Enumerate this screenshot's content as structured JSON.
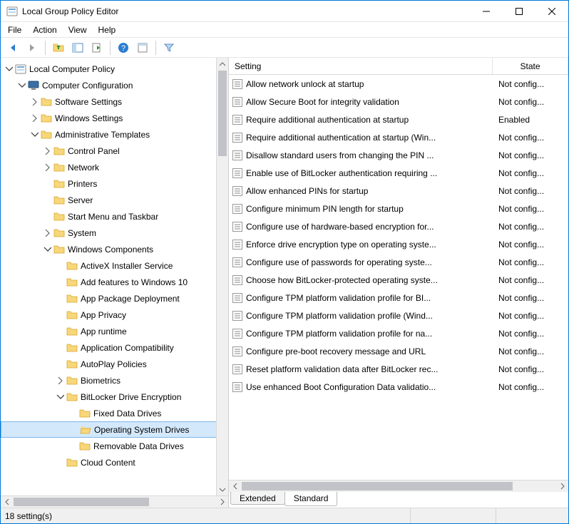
{
  "window": {
    "title": "Local Group Policy Editor"
  },
  "menubar": {
    "items": [
      "File",
      "Action",
      "View",
      "Help"
    ]
  },
  "tree": {
    "root": "Local Computer Policy",
    "nodes": [
      {
        "depth": 0,
        "exp": "open",
        "icon": "root",
        "label": "Local Computer Policy"
      },
      {
        "depth": 1,
        "exp": "open",
        "icon": "comp",
        "label": "Computer Configuration"
      },
      {
        "depth": 2,
        "exp": "closed",
        "icon": "folder",
        "label": "Software Settings"
      },
      {
        "depth": 2,
        "exp": "closed",
        "icon": "folder",
        "label": "Windows Settings"
      },
      {
        "depth": 2,
        "exp": "open",
        "icon": "folder",
        "label": "Administrative Templates"
      },
      {
        "depth": 3,
        "exp": "closed",
        "icon": "folder",
        "label": "Control Panel"
      },
      {
        "depth": 3,
        "exp": "closed",
        "icon": "folder",
        "label": "Network"
      },
      {
        "depth": 3,
        "exp": "none",
        "icon": "folder",
        "label": "Printers"
      },
      {
        "depth": 3,
        "exp": "none",
        "icon": "folder",
        "label": "Server"
      },
      {
        "depth": 3,
        "exp": "none",
        "icon": "folder",
        "label": "Start Menu and Taskbar"
      },
      {
        "depth": 3,
        "exp": "closed",
        "icon": "folder",
        "label": "System"
      },
      {
        "depth": 3,
        "exp": "open",
        "icon": "folder",
        "label": "Windows Components"
      },
      {
        "depth": 4,
        "exp": "none",
        "icon": "folder",
        "label": "ActiveX Installer Service"
      },
      {
        "depth": 4,
        "exp": "none",
        "icon": "folder",
        "label": "Add features to Windows 10"
      },
      {
        "depth": 4,
        "exp": "none",
        "icon": "folder",
        "label": "App Package Deployment"
      },
      {
        "depth": 4,
        "exp": "none",
        "icon": "folder",
        "label": "App Privacy"
      },
      {
        "depth": 4,
        "exp": "none",
        "icon": "folder",
        "label": "App runtime"
      },
      {
        "depth": 4,
        "exp": "none",
        "icon": "folder",
        "label": "Application Compatibility"
      },
      {
        "depth": 4,
        "exp": "none",
        "icon": "folder",
        "label": "AutoPlay Policies"
      },
      {
        "depth": 4,
        "exp": "closed",
        "icon": "folder",
        "label": "Biometrics"
      },
      {
        "depth": 4,
        "exp": "open",
        "icon": "folder",
        "label": "BitLocker Drive Encryption"
      },
      {
        "depth": 5,
        "exp": "none",
        "icon": "folder",
        "label": "Fixed Data Drives"
      },
      {
        "depth": 5,
        "exp": "none",
        "icon": "folder-open",
        "label": "Operating System Drives",
        "selected": true
      },
      {
        "depth": 5,
        "exp": "none",
        "icon": "folder",
        "label": "Removable Data Drives"
      },
      {
        "depth": 4,
        "exp": "none",
        "icon": "folder",
        "label": "Cloud Content"
      }
    ]
  },
  "list": {
    "columns": {
      "setting": "Setting",
      "state": "State"
    },
    "rows": [
      {
        "setting": "Allow network unlock at startup",
        "state": "Not config..."
      },
      {
        "setting": "Allow Secure Boot for integrity validation",
        "state": "Not config..."
      },
      {
        "setting": "Require additional authentication at startup",
        "state": "Enabled"
      },
      {
        "setting": "Require additional authentication at startup (Win...",
        "state": "Not config..."
      },
      {
        "setting": "Disallow standard users from changing the PIN ...",
        "state": "Not config..."
      },
      {
        "setting": "Enable use of BitLocker authentication requiring ...",
        "state": "Not config..."
      },
      {
        "setting": "Allow enhanced PINs for startup",
        "state": "Not config..."
      },
      {
        "setting": "Configure minimum PIN length for startup",
        "state": "Not config..."
      },
      {
        "setting": "Configure use of hardware-based encryption for...",
        "state": "Not config..."
      },
      {
        "setting": "Enforce drive encryption type on operating syste...",
        "state": "Not config..."
      },
      {
        "setting": "Configure use of passwords for operating syste...",
        "state": "Not config..."
      },
      {
        "setting": "Choose how BitLocker-protected operating syste...",
        "state": "Not config..."
      },
      {
        "setting": "Configure TPM platform validation profile for BI...",
        "state": "Not config..."
      },
      {
        "setting": "Configure TPM platform validation profile (Wind...",
        "state": "Not config..."
      },
      {
        "setting": "Configure TPM platform validation profile for na...",
        "state": "Not config..."
      },
      {
        "setting": "Configure pre-boot recovery message and URL",
        "state": "Not config..."
      },
      {
        "setting": "Reset platform validation data after BitLocker rec...",
        "state": "Not config..."
      },
      {
        "setting": "Use enhanced Boot Configuration Data validatio...",
        "state": "Not config..."
      }
    ]
  },
  "tabs": {
    "extended": "Extended",
    "standard": "Standard"
  },
  "statusbar": {
    "text": "18 setting(s)"
  }
}
